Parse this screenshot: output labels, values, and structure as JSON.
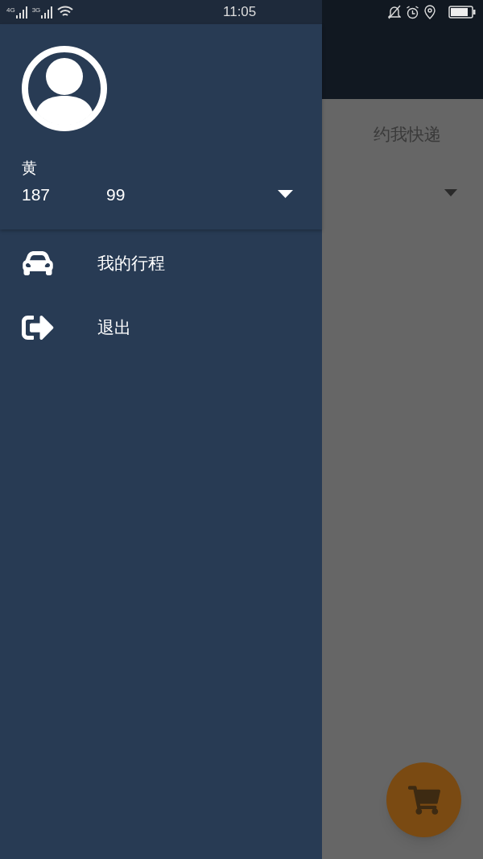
{
  "status_bar": {
    "network_1": "4G",
    "network_2": "3G",
    "time": "11:05"
  },
  "drawer": {
    "user_name": "黄",
    "phone_start": "187",
    "phone_end": "99",
    "menu": [
      {
        "kind": "car",
        "label": "我的行程"
      },
      {
        "kind": "exit",
        "label": "退出"
      }
    ]
  },
  "background_app": {
    "tab_label": "约我快递"
  }
}
